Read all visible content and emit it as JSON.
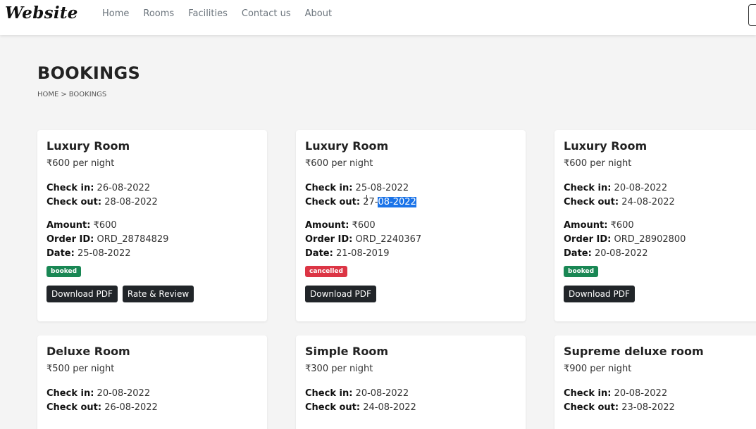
{
  "navbar": {
    "brand": "Website",
    "links": [
      "Home",
      "Rooms",
      "Facilities",
      "Contact us",
      "About"
    ]
  },
  "page": {
    "title": "BOOKINGS",
    "breadcrumb": {
      "home": "HOME",
      "sep": ">",
      "current": "BOOKINGS"
    }
  },
  "labels": {
    "check_in": "Check in:",
    "check_out": "Check out:",
    "amount": "Amount:",
    "order_id": "Order ID:",
    "date": "Date:",
    "download_pdf": "Download PDF",
    "rate_review": "Rate & Review"
  },
  "bookings": [
    {
      "room": "Luxury Room",
      "price": "₹600 per night",
      "check_in": "26-08-2022",
      "check_out": "28-08-2022",
      "amount": "₹600",
      "order_id": "ORD_28784829",
      "date": "25-08-2022",
      "status": "booked"
    },
    {
      "room": "Luxury Room",
      "price": "₹600 per night",
      "check_in": "25-08-2022",
      "check_out_a": "27-",
      "check_out_b": "08-2022",
      "amount": "₹600",
      "order_id": "ORD_2240367",
      "date": "21-08-2019",
      "status": "cancelled"
    },
    {
      "room": "Luxury Room",
      "price": "₹600 per night",
      "check_in": "20-08-2022",
      "check_out": "24-08-2022",
      "amount": "₹600",
      "order_id": "ORD_28902800",
      "date": "20-08-2022",
      "status": "booked"
    },
    {
      "room": "Deluxe Room",
      "price": "₹500 per night",
      "check_in": "20-08-2022",
      "check_out": "26-08-2022"
    },
    {
      "room": "Simple Room",
      "price": "₹300 per night",
      "check_in": "20-08-2022",
      "check_out": "24-08-2022"
    },
    {
      "room": "Supreme deluxe room",
      "price": "₹900 per night",
      "check_in": "20-08-2022",
      "check_out": "23-08-2022"
    }
  ]
}
